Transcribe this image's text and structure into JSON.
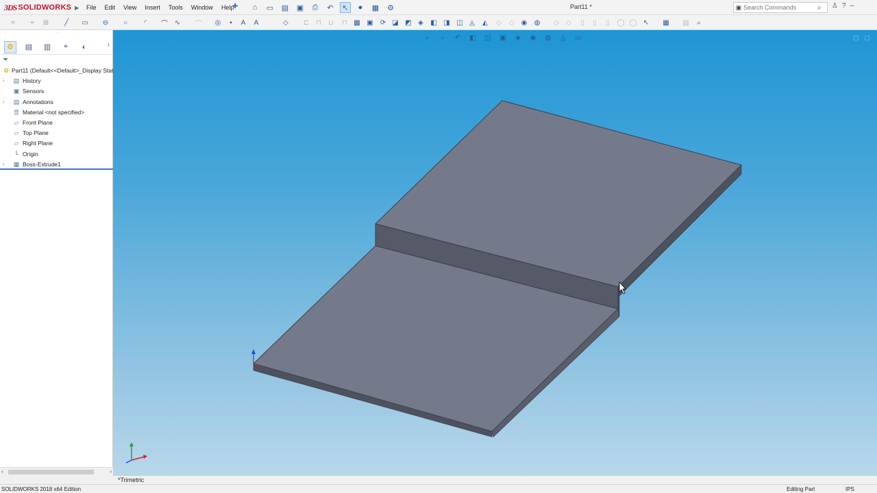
{
  "app": {
    "logo_prefix": "3DS",
    "logo_name": "SOLIDWORKS",
    "document_title": "Part11 *"
  },
  "menu": [
    "File",
    "Edit",
    "View",
    "Insert",
    "Tools",
    "Window",
    "Help"
  ],
  "search": {
    "placeholder": "Search Commands"
  },
  "feature_tree": {
    "root": "Part11  (Default<<Default>_Display Stat",
    "items": [
      {
        "label": "History",
        "icon": "history-folder-icon",
        "expandable": true
      },
      {
        "label": "Sensors",
        "icon": "sensor-icon",
        "expandable": false
      },
      {
        "label": "Annotations",
        "icon": "annotations-icon",
        "expandable": true
      },
      {
        "label": "Material <not specified>",
        "icon": "material-icon",
        "expandable": false
      },
      {
        "label": "Front Plane",
        "icon": "plane-icon",
        "expandable": false
      },
      {
        "label": "Top Plane",
        "icon": "plane-icon",
        "expandable": false
      },
      {
        "label": "Right Plane",
        "icon": "plane-icon",
        "expandable": false
      },
      {
        "label": "Origin",
        "icon": "origin-icon",
        "expandable": false
      },
      {
        "label": "Boss-Extrude1",
        "icon": "extrude-icon",
        "expandable": true
      }
    ],
    "selected_index": 8
  },
  "viewport": {
    "view_name": "*Trimetric",
    "background_top": "#1e95d4",
    "background_bottom": "#b9d7ea",
    "model_face_color": "#757a8b",
    "model_side_color": "#565a68"
  },
  "status": {
    "edition": "SOLIDWORKS 2018 x64 Edition",
    "mode": "Editing Part",
    "units": "IPS"
  },
  "colors": {
    "brand": "#c8102e",
    "selection_line": "#3a78c8"
  }
}
